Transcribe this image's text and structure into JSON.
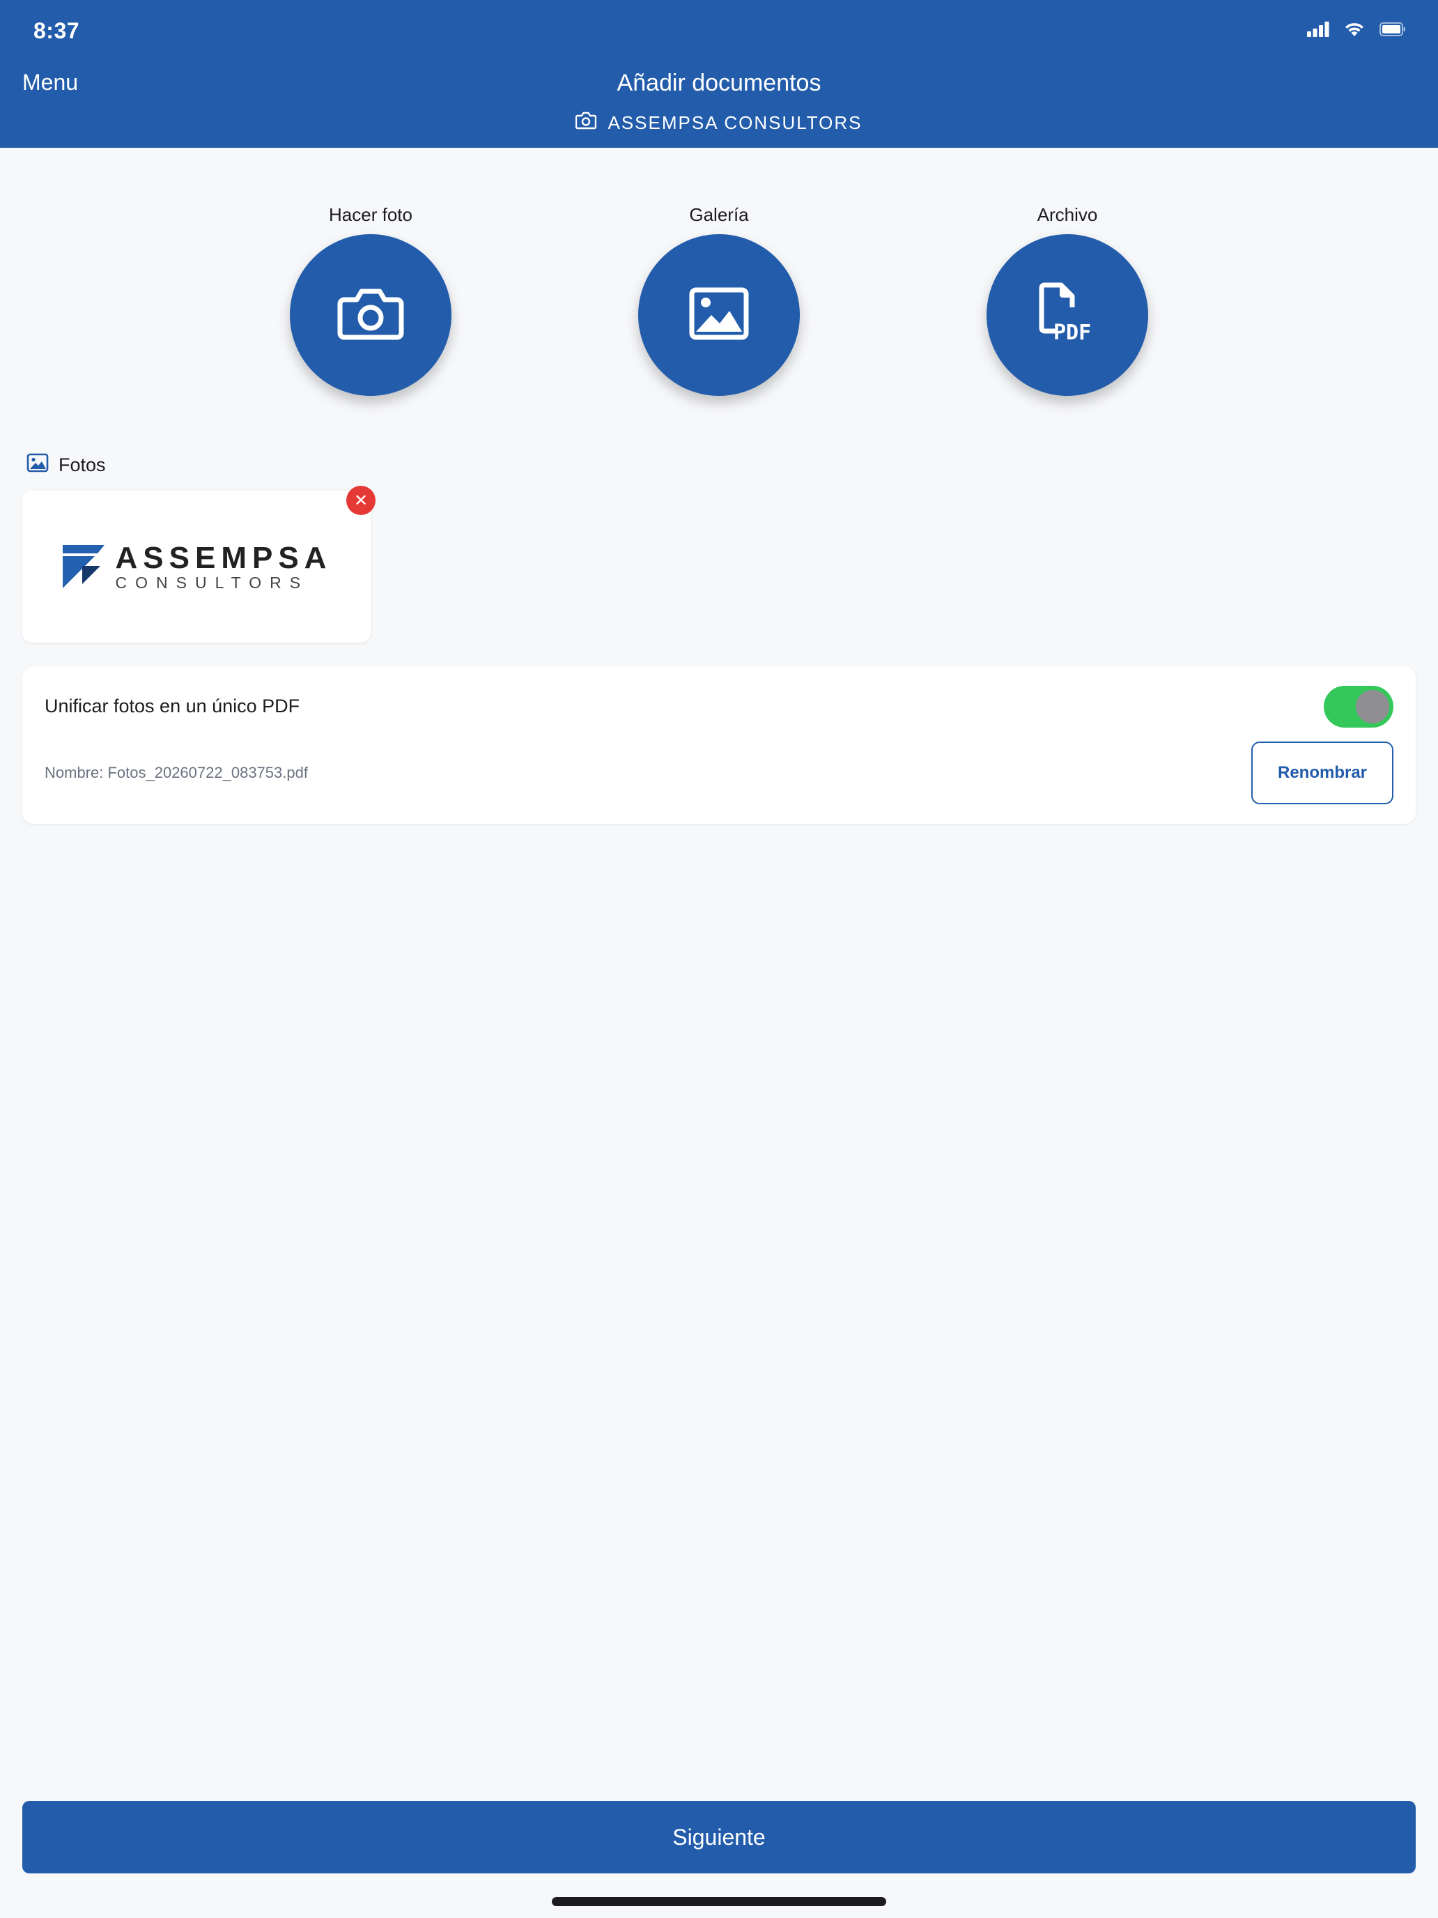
{
  "status_bar": {
    "time": "8:37",
    "icons": [
      "cellular-signal-icon",
      "wifi-icon",
      "battery-icon"
    ]
  },
  "header": {
    "menu_label": "Menu",
    "title": "Añadir documentos",
    "subtitle": "ASSEMPSA CONSULTORS",
    "subtitle_icon": "camera-icon",
    "background_color": "#225cab"
  },
  "actions": [
    {
      "label": "Hacer foto",
      "icon": "camera-icon"
    },
    {
      "label": "Galería",
      "icon": "image-icon"
    },
    {
      "label": "Archivo",
      "icon": "pdf-file-icon",
      "icon_text": "PDF"
    }
  ],
  "photos_section": {
    "heading": "Fotos",
    "heading_icon": "image-icon",
    "items": [
      {
        "logo_name": "ASSEMPSA",
        "logo_sub": "CONSULTORS",
        "remove_icon": "close-icon",
        "remove_glyph": "✕"
      }
    ]
  },
  "unify": {
    "label": "Unificar fotos en un único PDF",
    "enabled": true,
    "file_name": "Nombre: Fotos_20260722_083753.pdf",
    "rename_label": "Renombrar",
    "toggle_color": "#34c759"
  },
  "footer": {
    "next_label": "Siguiente"
  }
}
